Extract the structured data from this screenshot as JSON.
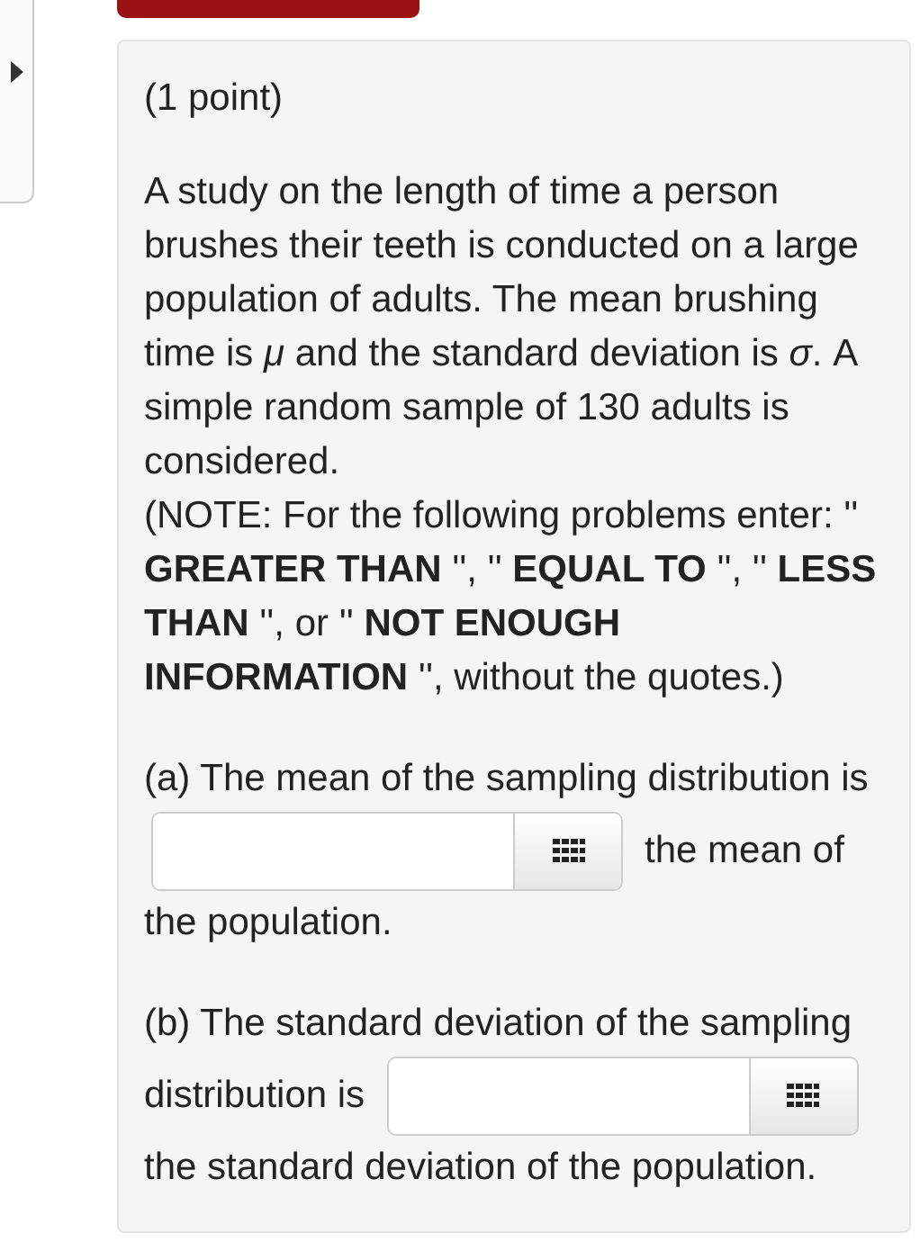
{
  "problem": {
    "points": "(1 point)",
    "statement": "A study on the length of time a person brushes their teeth is conducted on a large population of adults. The mean brushing time is *μ* and the standard deviation is *σ*. A simple random sample of 130 adults is considered.",
    "note": "(NOTE: For the following problems enter: '' **GREATER THAN** '', '' **EQUAL TO** '', '' **LESS THAN** '', or '' **NOT ENOUGH INFORMATION** '', without the quotes.)",
    "parts": [
      {
        "lines_before": [
          "(a) The mean of the sampling distribution is"
        ],
        "text_after_field": "the mean of",
        "lines_after": [
          "the population."
        ]
      },
      {
        "lines_before": [
          "(b) The standard deviation of the sampling"
        ],
        "text_before_field": "distribution is",
        "lines_after": [
          "the standard deviation of the population."
        ]
      }
    ]
  }
}
